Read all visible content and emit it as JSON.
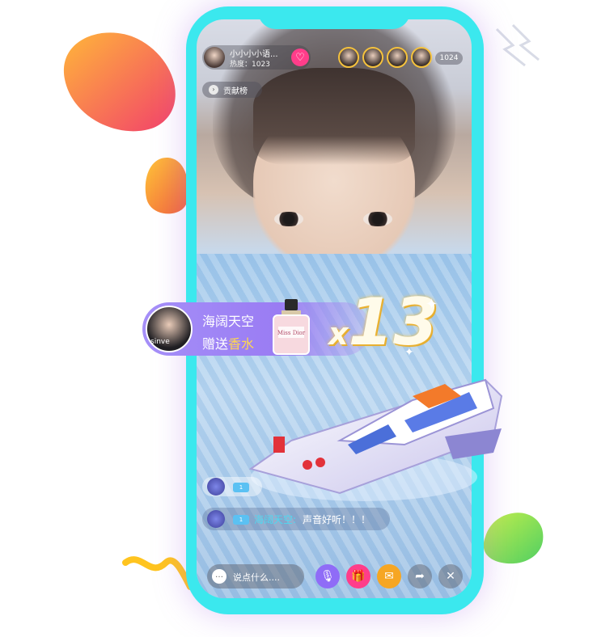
{
  "host": {
    "name": "小小小小语...",
    "heat": "热度：1023",
    "follow_icon": "heart-icon"
  },
  "viewers": {
    "count": "1024",
    "avatars": [
      "viewer-avatar",
      "viewer-avatar",
      "viewer-avatar",
      "viewer-avatar"
    ]
  },
  "rank": {
    "label": "贡献榜",
    "icon": "rank-icon"
  },
  "gift": {
    "sender": "海阔天空",
    "action": "赠送",
    "item": "香水",
    "multiplier": "x",
    "count": "13",
    "avatar_text": "sinve",
    "bottle_text": "Miss Dior"
  },
  "chat": [
    {
      "badge": "1",
      "name": "",
      "message": ""
    },
    {
      "badge": "1",
      "name": "海阔天空:",
      "message": "声音好听！！！"
    }
  ],
  "bottom_bar": {
    "input_placeholder": "说点什么....",
    "buttons": [
      "mic-icon",
      "gift-icon",
      "mail-icon",
      "share-icon",
      "close-icon"
    ]
  },
  "colors": {
    "phone_frame": "#3be8ee",
    "follow": "#ff3d8a",
    "gift_bar": "#9a7cf3",
    "gift_item": "#ffd84d",
    "chat_name": "#4fd7f0",
    "mic_button": "#8f6cf7",
    "gift_button": "#ff3d8a",
    "mail_button": "#f6a623"
  }
}
